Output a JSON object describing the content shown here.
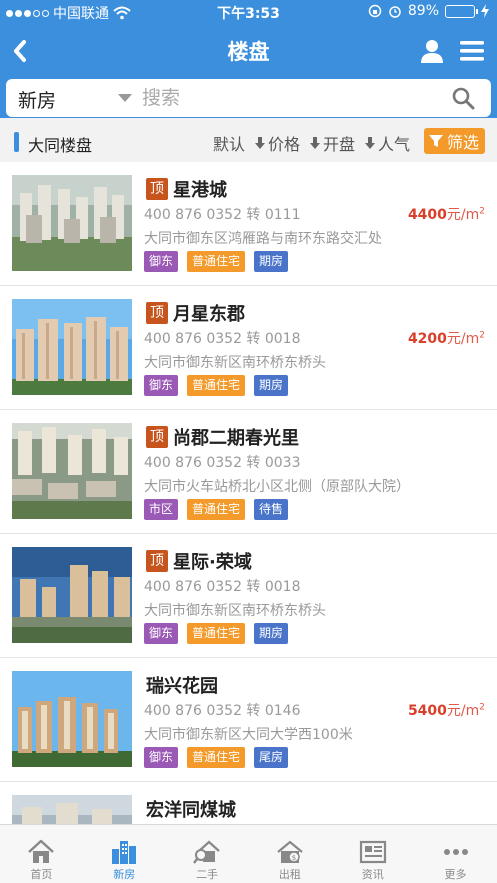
{
  "status_bar": {
    "carrier": "中国联通",
    "time": "下午3:53",
    "battery": "89%",
    "battery_level": 0.89
  },
  "nav": {
    "title": "楼盘"
  },
  "search": {
    "type": "新房",
    "placeholder": "搜索"
  },
  "filter": {
    "section_title": "大同楼盘",
    "options": [
      "默认",
      "价格",
      "开盘",
      "人气"
    ],
    "filter_button": "筛选"
  },
  "listings": [
    {
      "badge": "顶",
      "name": "星港城",
      "phone": "400 876 0352 转 0111",
      "address": "大同市御东区鸿雁路与南环东路交汇处",
      "tags": [
        "御东",
        "普通住宅",
        "期房"
      ],
      "price": "4400",
      "unit": "元/m",
      "sup": "2"
    },
    {
      "badge": "顶",
      "name": "月星东郡",
      "phone": "400 876 0352 转 0018",
      "address": "大同市御东新区南环桥东桥头",
      "tags": [
        "御东",
        "普通住宅",
        "期房"
      ],
      "price": "4200",
      "unit": "元/m",
      "sup": "2"
    },
    {
      "badge": "顶",
      "name": "尚郡二期春光里",
      "phone": "400 876 0352 转 0033",
      "address": "大同市火车站桥北小区北侧（原部队大院）",
      "tags": [
        "市区",
        "普通住宅",
        "待售"
      ],
      "price": "",
      "unit": "",
      "sup": ""
    },
    {
      "badge": "顶",
      "name": "星际·荣域",
      "phone": "400 876 0352 转 0018",
      "address": "大同市御东新区南环桥东桥头",
      "tags": [
        "御东",
        "普通住宅",
        "期房"
      ],
      "price": "",
      "unit": "",
      "sup": ""
    },
    {
      "badge": "",
      "name": "瑞兴花园",
      "phone": "400 876 0352 转 0146",
      "address": "大同市御东新区大同大学西100米",
      "tags": [
        "御东",
        "普通住宅",
        "尾房"
      ],
      "price": "5400",
      "unit": "元/m",
      "sup": "2"
    },
    {
      "badge": "",
      "name": "宏洋同煤城",
      "phone": "",
      "address": "",
      "tags": [],
      "price": "",
      "unit": "",
      "sup": ""
    }
  ],
  "tabbar": {
    "items": [
      {
        "label": "首页",
        "icon": "home-icon"
      },
      {
        "label": "新房",
        "icon": "buildings-icon",
        "active": true
      },
      {
        "label": "二手",
        "icon": "house-search-icon"
      },
      {
        "label": "出租",
        "icon": "rent-house-icon"
      },
      {
        "label": "资讯",
        "icon": "news-icon"
      },
      {
        "label": "更多",
        "icon": "more-dots-icon"
      }
    ]
  },
  "colors": {
    "primary": "#3b8fdc",
    "accent": "#f39a2b",
    "badge": "#c6541c",
    "price": "#d9402b"
  }
}
